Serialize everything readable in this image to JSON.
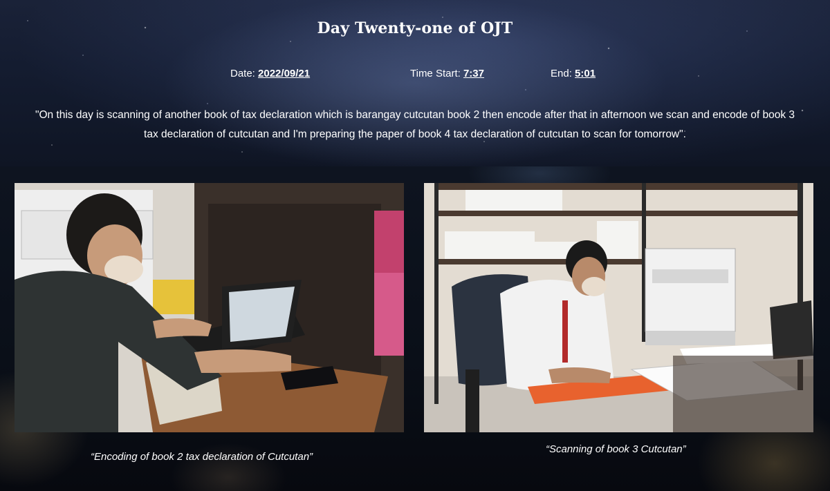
{
  "header": {
    "title": "Day Twenty-one of OJT",
    "date_label": "Date: ",
    "date_value": "2022/09/21",
    "start_label": "Time Start: ",
    "start_value": "7:37",
    "end_label": "End: ",
    "end_value": "5:01",
    "description": "\"On this day is scanning of another book of tax declaration which is barangay cutcutan book 2 then encode after that in afternoon we scan and encode of book 3 tax declaration of cutcutan and I'm preparing the paper of book 4 tax declaration of cutcutan to scan for tomorrow\"."
  },
  "photos": [
    {
      "caption": "“Encoding of book 2 tax declaration of Cutcutan”"
    },
    {
      "caption": "“Scanning of book 3 Cutcutan”"
    }
  ],
  "colors": {
    "header_bg": "#141c30",
    "lower_bg": "#0a0f18",
    "text": "#ffffff"
  }
}
